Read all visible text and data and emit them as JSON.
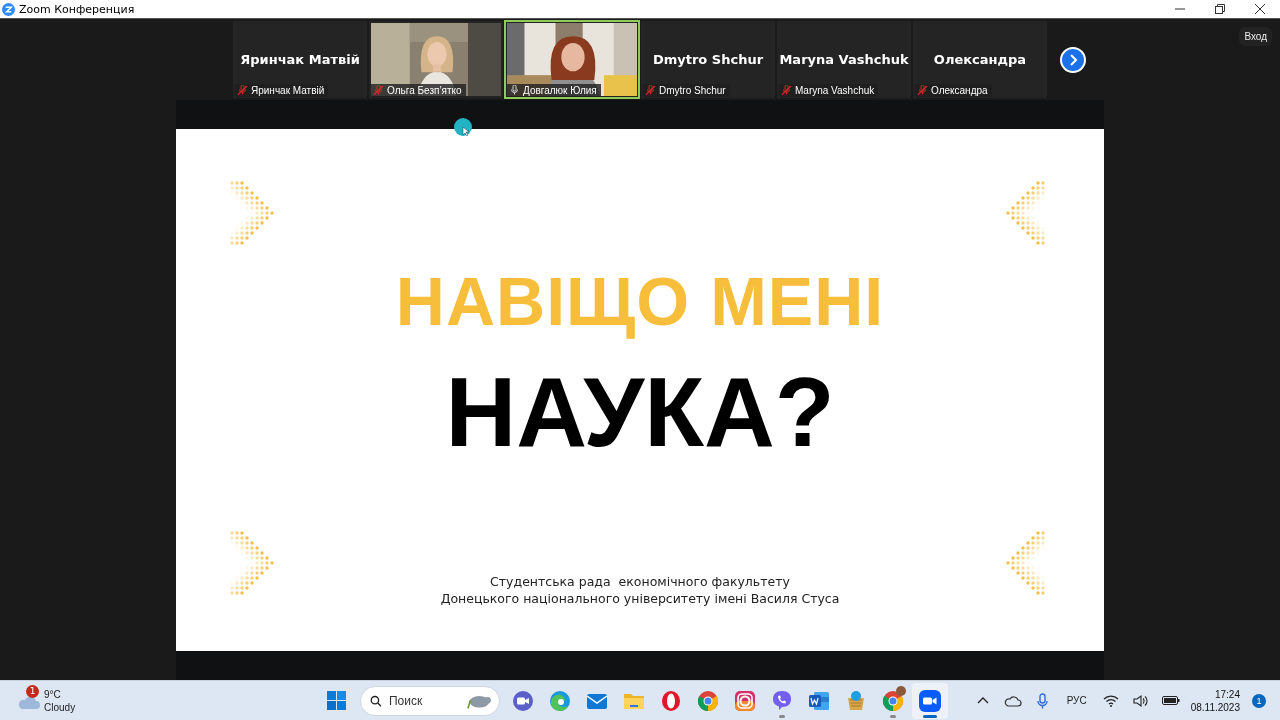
{
  "window": {
    "title": "Zoom Конференция"
  },
  "participants": [
    {
      "display_name": "Яринчак Матвій",
      "name": "Яринчак Матвій",
      "kind": "name",
      "muted": true,
      "speaking": false
    },
    {
      "name": "Ольга Безп’ятко",
      "kind": "video",
      "muted": true,
      "speaking": false
    },
    {
      "name": "Довгалюк Юлия",
      "kind": "video",
      "muted": false,
      "speaking": true
    },
    {
      "display_name": "Dmytro Shchur",
      "name": "Dmytro Shchur",
      "kind": "name",
      "muted": true,
      "speaking": false
    },
    {
      "display_name": "Maryna Vashchuk",
      "name": "Maryna Vashchuk",
      "kind": "name",
      "muted": true,
      "speaking": false
    },
    {
      "display_name": "Олександра",
      "name": "Олександра",
      "kind": "name",
      "muted": true,
      "speaking": false
    }
  ],
  "sign_in_button": "Вход",
  "slide": {
    "heading": "НАВІЩО МЕНІ",
    "subject": "НАУКА?",
    "footer": [
      "Студентська рада  економічного факультету",
      "Донецького національного університету імені Василя Стуса"
    ]
  },
  "taskbar": {
    "weather": {
      "badge": "1",
      "temperature": "9°C",
      "condition": "Cloudy"
    },
    "search": {
      "placeholder": "Поиск"
    },
    "apps": [
      {
        "kind": "meet",
        "running": false,
        "active": false
      },
      {
        "kind": "edge",
        "running": false,
        "active": false
      },
      {
        "kind": "mail",
        "running": false,
        "active": false
      },
      {
        "kind": "folder",
        "running": false,
        "active": false
      },
      {
        "kind": "opera",
        "running": false,
        "active": false
      },
      {
        "kind": "chrome",
        "running": false,
        "active": false
      },
      {
        "kind": "instagram",
        "running": false,
        "active": false
      },
      {
        "kind": "viber",
        "running": true,
        "active": false
      },
      {
        "kind": "word",
        "running": false,
        "active": false
      },
      {
        "kind": "store",
        "running": false,
        "active": false
      },
      {
        "kind": "chrome",
        "running": true,
        "active": false
      },
      {
        "kind": "zoom",
        "running": true,
        "active": true
      }
    ],
    "tray": {
      "language": "РУС",
      "time": "17:24",
      "date": "08.11.2023",
      "notifications": "1"
    }
  }
}
